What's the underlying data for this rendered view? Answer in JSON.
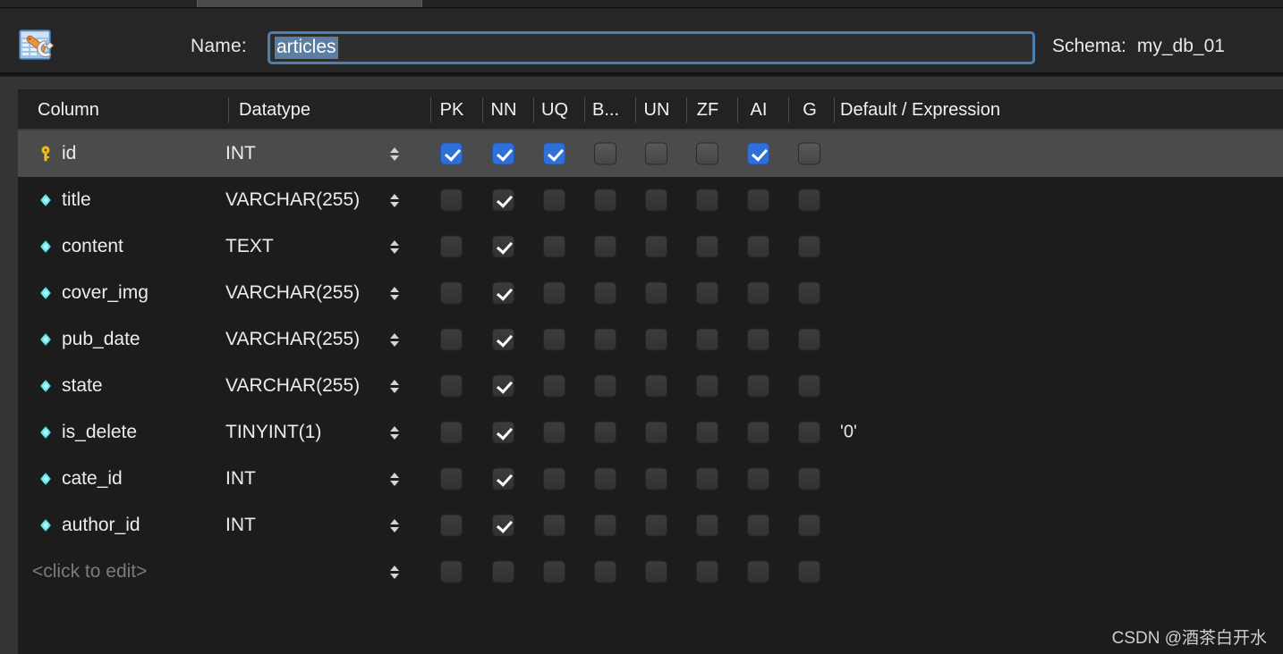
{
  "window": {
    "app_icon": "table-wrench-icon",
    "tab_strip": {
      "active_tab_present": true
    }
  },
  "header": {
    "name_label": "Name:",
    "name_value": "articles",
    "name_placeholder": "",
    "schema_label": "Schema:",
    "schema_value": "my_db_01"
  },
  "grid": {
    "columns": [
      {
        "key": "column",
        "label": "Column"
      },
      {
        "key": "datatype",
        "label": "Datatype"
      },
      {
        "key": "pk",
        "label": "PK"
      },
      {
        "key": "nn",
        "label": "NN"
      },
      {
        "key": "uq",
        "label": "UQ"
      },
      {
        "key": "b",
        "label": "B..."
      },
      {
        "key": "un",
        "label": "UN"
      },
      {
        "key": "zf",
        "label": "ZF"
      },
      {
        "key": "ai",
        "label": "AI"
      },
      {
        "key": "g",
        "label": "G"
      },
      {
        "key": "default",
        "label": "Default / Expression"
      }
    ],
    "rows": [
      {
        "icon": "primary-key-icon",
        "name": "id",
        "datatype": "INT",
        "pk": true,
        "nn": true,
        "uq": true,
        "b": false,
        "un": false,
        "zf": false,
        "ai": true,
        "g": false,
        "default": "",
        "selected": true,
        "placeholder": false
      },
      {
        "icon": "column-diamond-icon",
        "name": "title",
        "datatype": "VARCHAR(255)",
        "pk": false,
        "nn": true,
        "uq": false,
        "b": false,
        "un": false,
        "zf": false,
        "ai": false,
        "g": false,
        "default": "",
        "selected": false,
        "placeholder": false
      },
      {
        "icon": "column-diamond-icon",
        "name": "content",
        "datatype": "TEXT",
        "pk": false,
        "nn": true,
        "uq": false,
        "b": false,
        "un": false,
        "zf": false,
        "ai": false,
        "g": false,
        "default": "",
        "selected": false,
        "placeholder": false
      },
      {
        "icon": "column-diamond-icon",
        "name": "cover_img",
        "datatype": "VARCHAR(255)",
        "pk": false,
        "nn": true,
        "uq": false,
        "b": false,
        "un": false,
        "zf": false,
        "ai": false,
        "g": false,
        "default": "",
        "selected": false,
        "placeholder": false
      },
      {
        "icon": "column-diamond-icon",
        "name": "pub_date",
        "datatype": "VARCHAR(255)",
        "pk": false,
        "nn": true,
        "uq": false,
        "b": false,
        "un": false,
        "zf": false,
        "ai": false,
        "g": false,
        "default": "",
        "selected": false,
        "placeholder": false
      },
      {
        "icon": "column-diamond-icon",
        "name": "state",
        "datatype": "VARCHAR(255)",
        "pk": false,
        "nn": true,
        "uq": false,
        "b": false,
        "un": false,
        "zf": false,
        "ai": false,
        "g": false,
        "default": "",
        "selected": false,
        "placeholder": false
      },
      {
        "icon": "column-diamond-icon",
        "name": "is_delete",
        "datatype": "TINYINT(1)",
        "pk": false,
        "nn": true,
        "uq": false,
        "b": false,
        "un": false,
        "zf": false,
        "ai": false,
        "g": false,
        "default": "'0'",
        "selected": false,
        "placeholder": false
      },
      {
        "icon": "column-diamond-icon",
        "name": "cate_id",
        "datatype": "INT",
        "pk": false,
        "nn": true,
        "uq": false,
        "b": false,
        "un": false,
        "zf": false,
        "ai": false,
        "g": false,
        "default": "",
        "selected": false,
        "placeholder": false
      },
      {
        "icon": "column-diamond-icon",
        "name": "author_id",
        "datatype": "INT",
        "pk": false,
        "nn": true,
        "uq": false,
        "b": false,
        "un": false,
        "zf": false,
        "ai": false,
        "g": false,
        "default": "",
        "selected": false,
        "placeholder": false
      },
      {
        "icon": "",
        "name": "<click to edit>",
        "datatype": "",
        "pk": false,
        "nn": false,
        "uq": false,
        "b": false,
        "un": false,
        "zf": false,
        "ai": false,
        "g": false,
        "default": "",
        "selected": false,
        "placeholder": true
      }
    ]
  },
  "watermark": "CSDN @酒茶白开水",
  "colors": {
    "accent_blue": "#2f6fd8",
    "field_border": "#4a7fae",
    "selection_blue": "#5b7ea3",
    "panel_bg": "#1c1c1c",
    "header_bg": "#262626",
    "row_selected": "#4b4b4b",
    "key_yellow": "#f2c230",
    "diamond_cyan": "#6ff0f0"
  },
  "layout": {
    "flag_x": [
      472,
      530,
      587,
      644,
      701,
      758,
      815,
      872
    ],
    "sep_x": [
      235,
      461,
      519,
      576,
      633,
      690,
      747,
      804,
      861,
      912
    ],
    "head_x": {
      "column": 22,
      "datatype": 247,
      "default": 919
    }
  }
}
